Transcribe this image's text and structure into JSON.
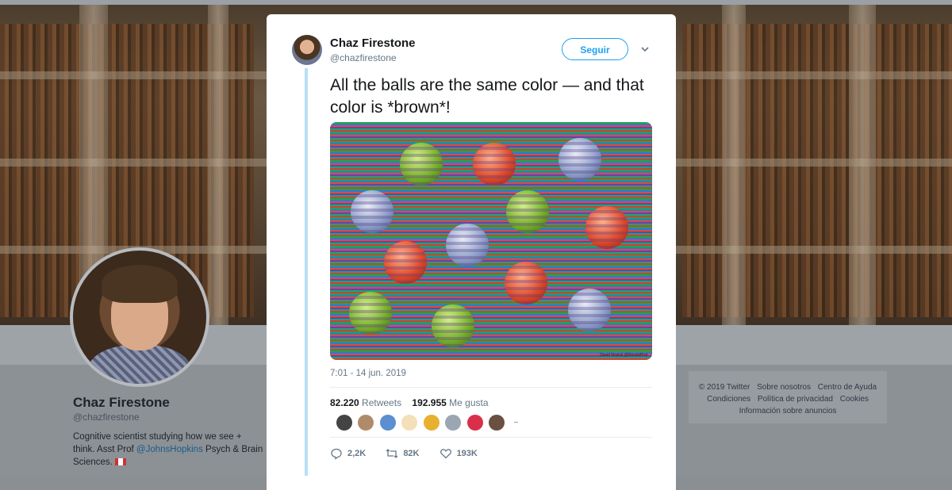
{
  "profile": {
    "name": "Chaz Firestone",
    "handle": "@chazfirestone",
    "bio_text": "Cognitive scientist studying how we see + think. Asst Prof ",
    "bio_link": "@JohnsHopkins",
    "bio_suffix": " Psych & Brain Sciences."
  },
  "tweet": {
    "author_name": "Chaz Firestone",
    "author_handle": "@chazfirestone",
    "follow_label": "Seguir",
    "text": "All the balls are the same color — and that color is *brown*!",
    "image_credit": "David Novick @NovickProf",
    "timestamp": "7:01 - 14 jun. 2019",
    "retweets_count": "82.220",
    "retweets_label": "Retweets",
    "likes_count": "192.955",
    "likes_label": "Me gusta",
    "actions": {
      "reply_count": "2,2K",
      "retweet_count": "82K",
      "like_count": "193K"
    }
  },
  "footer": {
    "row1": [
      "© 2019 Twitter",
      "Sobre nosotros",
      "Centro de Ayuda"
    ],
    "row2": [
      "Condiciones",
      "Política de privacidad",
      "Cookies"
    ],
    "row3": [
      "Información sobre anuncios"
    ]
  },
  "colors": {
    "accent": "#1da1f2",
    "thread_line": "#b9dff6",
    "ball_green": "#78b02a",
    "ball_red": "#e04a28",
    "ball_blue": "#8ea0c8"
  }
}
